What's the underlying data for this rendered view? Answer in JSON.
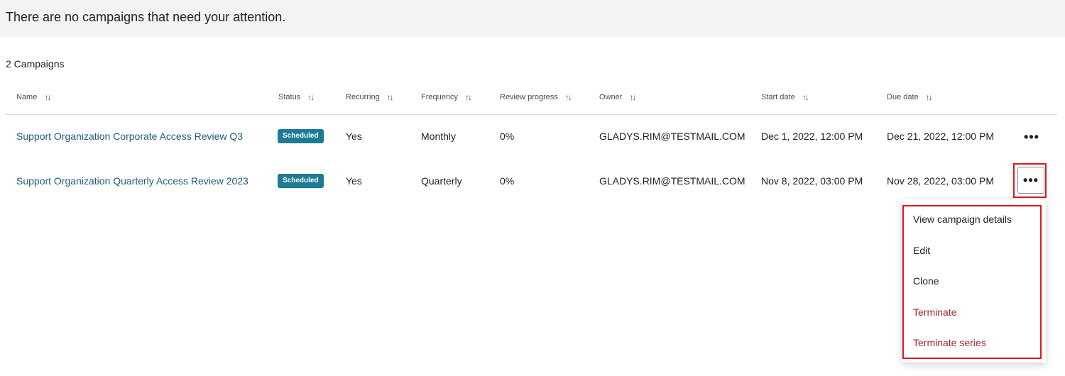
{
  "banner": {
    "message": "There are no campaigns that need your attention."
  },
  "campaign_count": "2 Campaigns",
  "table": {
    "headers": [
      "Name",
      "Status",
      "Recurring",
      "Frequency",
      "Review progress",
      "Owner",
      "Start date",
      "Due date"
    ],
    "sort_icon": "sort-arrows-icon",
    "rows": [
      {
        "name": "Support Organization Corporate Access Review Q3",
        "status": "Scheduled",
        "recurring": "Yes",
        "frequency": "Monthly",
        "progress": "0%",
        "owner": "GLADYS.RIM@TESTMAIL.COM",
        "start": "Dec 1, 2022, 12:00 PM",
        "due": "Dec 21, 2022, 12:00 PM"
      },
      {
        "name": "Support Organization Quarterly Access Review 2023",
        "status": "Scheduled",
        "recurring": "Yes",
        "frequency": "Quarterly",
        "progress": "0%",
        "owner": "GLADYS.RIM@TESTMAIL.COM",
        "start": "Nov 8, 2022, 03:00 PM",
        "due": "Nov 28, 2022, 03:00 PM"
      }
    ]
  },
  "more_button_glyph": "•••",
  "context_menu": {
    "items": [
      {
        "label": "View campaign details",
        "style": "normal"
      },
      {
        "label": "Edit",
        "style": "normal"
      },
      {
        "label": "Clone",
        "style": "normal"
      },
      {
        "label": "Terminate",
        "style": "danger"
      },
      {
        "label": "Terminate series",
        "style": "danger"
      }
    ]
  },
  "colors": {
    "link": "#1b5e7f",
    "badge": "#1d7b95",
    "danger": "#a4262c",
    "highlight": "#e0161b",
    "banner_bg": "#f4f3f1"
  }
}
